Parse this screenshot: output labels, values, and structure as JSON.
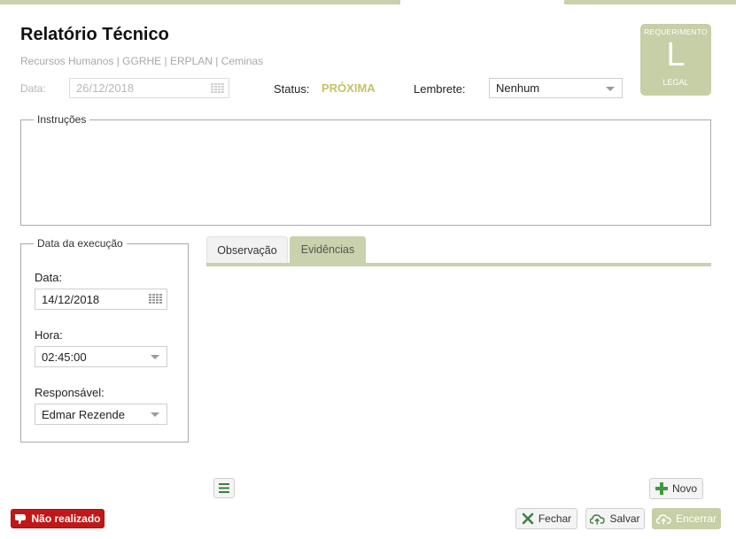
{
  "header": {
    "title": "Relatório Técnico",
    "breadcrumb": "Recursos Humanos | GGRHE | ERPLAN | Ceminas"
  },
  "info": {
    "date_label": "Data:",
    "date_value": "26/12/2018",
    "status_label": "Status:",
    "status_value": "PRÓXIMA",
    "reminder_label": "Lembrete:",
    "reminder_value": "Nenhum"
  },
  "badge": {
    "top": "REQUERIMENTO",
    "letter": "L",
    "bottom": "LEGAL"
  },
  "instructions": {
    "legend": "Instruções"
  },
  "execution": {
    "legend": "Data da execução",
    "date_label": "Data:",
    "date_value": "14/12/2018",
    "time_label": "Hora:",
    "time_value": "02:45:00",
    "responsible_label": "Responsável:",
    "responsible_value": "Edmar Rezende"
  },
  "tabs": [
    {
      "label": "Observação",
      "active": false
    },
    {
      "label": "Evidências",
      "active": true
    }
  ],
  "actions": {
    "new_label": "Novo",
    "not_done_label": "Não realizado",
    "close_label": "Fechar",
    "save_label": "Salvar",
    "finish_label": "Encerrar"
  },
  "colors": {
    "accent": "#c9d1ad",
    "status": "#c2c26a",
    "danger": "#c01818",
    "add_green": "#3f9a3f"
  }
}
